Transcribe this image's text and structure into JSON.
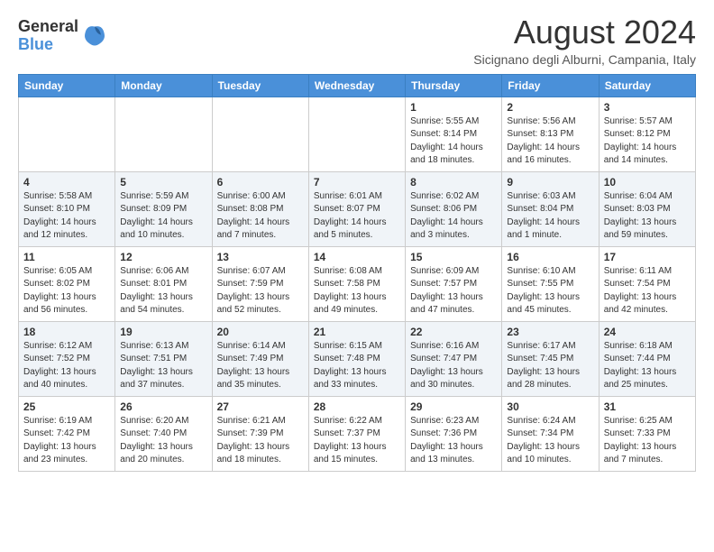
{
  "logo": {
    "line1": "General",
    "line2": "Blue"
  },
  "title": "August 2024",
  "subtitle": "Sicignano degli Alburni, Campania, Italy",
  "headers": [
    "Sunday",
    "Monday",
    "Tuesday",
    "Wednesday",
    "Thursday",
    "Friday",
    "Saturday"
  ],
  "weeks": [
    [
      {
        "day": "",
        "info": ""
      },
      {
        "day": "",
        "info": ""
      },
      {
        "day": "",
        "info": ""
      },
      {
        "day": "",
        "info": ""
      },
      {
        "day": "1",
        "info": "Sunrise: 5:55 AM\nSunset: 8:14 PM\nDaylight: 14 hours\nand 18 minutes."
      },
      {
        "day": "2",
        "info": "Sunrise: 5:56 AM\nSunset: 8:13 PM\nDaylight: 14 hours\nand 16 minutes."
      },
      {
        "day": "3",
        "info": "Sunrise: 5:57 AM\nSunset: 8:12 PM\nDaylight: 14 hours\nand 14 minutes."
      }
    ],
    [
      {
        "day": "4",
        "info": "Sunrise: 5:58 AM\nSunset: 8:10 PM\nDaylight: 14 hours\nand 12 minutes."
      },
      {
        "day": "5",
        "info": "Sunrise: 5:59 AM\nSunset: 8:09 PM\nDaylight: 14 hours\nand 10 minutes."
      },
      {
        "day": "6",
        "info": "Sunrise: 6:00 AM\nSunset: 8:08 PM\nDaylight: 14 hours\nand 7 minutes."
      },
      {
        "day": "7",
        "info": "Sunrise: 6:01 AM\nSunset: 8:07 PM\nDaylight: 14 hours\nand 5 minutes."
      },
      {
        "day": "8",
        "info": "Sunrise: 6:02 AM\nSunset: 8:06 PM\nDaylight: 14 hours\nand 3 minutes."
      },
      {
        "day": "9",
        "info": "Sunrise: 6:03 AM\nSunset: 8:04 PM\nDaylight: 14 hours\nand 1 minute."
      },
      {
        "day": "10",
        "info": "Sunrise: 6:04 AM\nSunset: 8:03 PM\nDaylight: 13 hours\nand 59 minutes."
      }
    ],
    [
      {
        "day": "11",
        "info": "Sunrise: 6:05 AM\nSunset: 8:02 PM\nDaylight: 13 hours\nand 56 minutes."
      },
      {
        "day": "12",
        "info": "Sunrise: 6:06 AM\nSunset: 8:01 PM\nDaylight: 13 hours\nand 54 minutes."
      },
      {
        "day": "13",
        "info": "Sunrise: 6:07 AM\nSunset: 7:59 PM\nDaylight: 13 hours\nand 52 minutes."
      },
      {
        "day": "14",
        "info": "Sunrise: 6:08 AM\nSunset: 7:58 PM\nDaylight: 13 hours\nand 49 minutes."
      },
      {
        "day": "15",
        "info": "Sunrise: 6:09 AM\nSunset: 7:57 PM\nDaylight: 13 hours\nand 47 minutes."
      },
      {
        "day": "16",
        "info": "Sunrise: 6:10 AM\nSunset: 7:55 PM\nDaylight: 13 hours\nand 45 minutes."
      },
      {
        "day": "17",
        "info": "Sunrise: 6:11 AM\nSunset: 7:54 PM\nDaylight: 13 hours\nand 42 minutes."
      }
    ],
    [
      {
        "day": "18",
        "info": "Sunrise: 6:12 AM\nSunset: 7:52 PM\nDaylight: 13 hours\nand 40 minutes."
      },
      {
        "day": "19",
        "info": "Sunrise: 6:13 AM\nSunset: 7:51 PM\nDaylight: 13 hours\nand 37 minutes."
      },
      {
        "day": "20",
        "info": "Sunrise: 6:14 AM\nSunset: 7:49 PM\nDaylight: 13 hours\nand 35 minutes."
      },
      {
        "day": "21",
        "info": "Sunrise: 6:15 AM\nSunset: 7:48 PM\nDaylight: 13 hours\nand 33 minutes."
      },
      {
        "day": "22",
        "info": "Sunrise: 6:16 AM\nSunset: 7:47 PM\nDaylight: 13 hours\nand 30 minutes."
      },
      {
        "day": "23",
        "info": "Sunrise: 6:17 AM\nSunset: 7:45 PM\nDaylight: 13 hours\nand 28 minutes."
      },
      {
        "day": "24",
        "info": "Sunrise: 6:18 AM\nSunset: 7:44 PM\nDaylight: 13 hours\nand 25 minutes."
      }
    ],
    [
      {
        "day": "25",
        "info": "Sunrise: 6:19 AM\nSunset: 7:42 PM\nDaylight: 13 hours\nand 23 minutes."
      },
      {
        "day": "26",
        "info": "Sunrise: 6:20 AM\nSunset: 7:40 PM\nDaylight: 13 hours\nand 20 minutes."
      },
      {
        "day": "27",
        "info": "Sunrise: 6:21 AM\nSunset: 7:39 PM\nDaylight: 13 hours\nand 18 minutes."
      },
      {
        "day": "28",
        "info": "Sunrise: 6:22 AM\nSunset: 7:37 PM\nDaylight: 13 hours\nand 15 minutes."
      },
      {
        "day": "29",
        "info": "Sunrise: 6:23 AM\nSunset: 7:36 PM\nDaylight: 13 hours\nand 13 minutes."
      },
      {
        "day": "30",
        "info": "Sunrise: 6:24 AM\nSunset: 7:34 PM\nDaylight: 13 hours\nand 10 minutes."
      },
      {
        "day": "31",
        "info": "Sunrise: 6:25 AM\nSunset: 7:33 PM\nDaylight: 13 hours\nand 7 minutes."
      }
    ]
  ]
}
